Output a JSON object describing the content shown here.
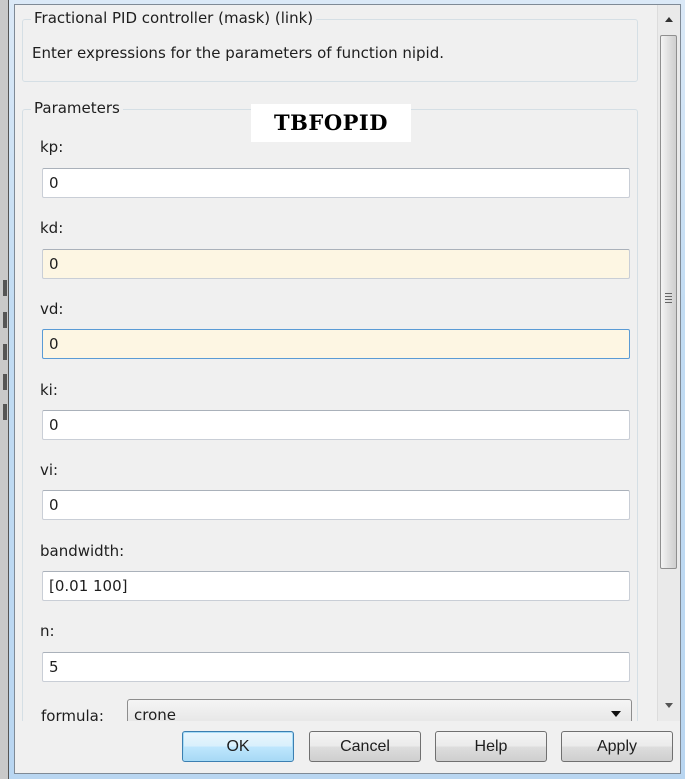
{
  "header": {
    "group_title": "Fractional PID controller (mask) (link)",
    "description": "Enter expressions for the parameters of function nipid."
  },
  "parameters": {
    "group_title": "Parameters",
    "overlay_label": "TBFOPID",
    "fields": [
      {
        "label": "kp:",
        "value": "0",
        "state": "normal"
      },
      {
        "label": "kd:",
        "value": "0",
        "state": "modified"
      },
      {
        "label": "vd:",
        "value": "0",
        "state": "modified-focused"
      },
      {
        "label": "ki:",
        "value": "0",
        "state": "normal"
      },
      {
        "label": "vi:",
        "value": "0",
        "state": "normal"
      },
      {
        "label": "bandwidth:",
        "value": "[0.01 100]",
        "state": "normal"
      },
      {
        "label": "n:",
        "value": "5",
        "state": "normal"
      }
    ],
    "formula": {
      "label": "formula:",
      "selected": "crone"
    }
  },
  "buttons": {
    "ok": "OK",
    "cancel": "Cancel",
    "help": "Help",
    "apply": "Apply"
  },
  "scrollbar": {
    "up_icon": "arrow-up-icon",
    "down_icon": "arrow-down-icon",
    "grip_icon": "grip-icon"
  },
  "colors": {
    "dialog_bg": "#f0f0f0",
    "modified_field_bg": "#fdf6e3",
    "focus_border": "#5a9bd5",
    "default_button_border": "#3c7fb1"
  }
}
